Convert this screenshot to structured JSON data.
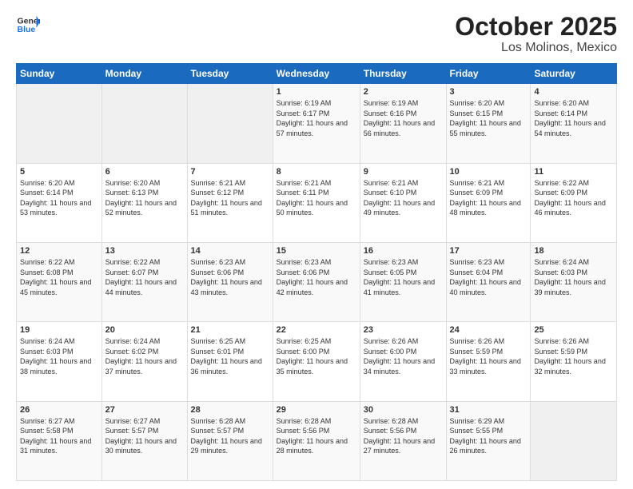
{
  "header": {
    "logo_general": "General",
    "logo_blue": "Blue",
    "month_title": "October 2025",
    "location": "Los Molinos, Mexico"
  },
  "days_of_week": [
    "Sunday",
    "Monday",
    "Tuesday",
    "Wednesday",
    "Thursday",
    "Friday",
    "Saturday"
  ],
  "weeks": [
    [
      {
        "day": "",
        "info": ""
      },
      {
        "day": "",
        "info": ""
      },
      {
        "day": "",
        "info": ""
      },
      {
        "day": "1",
        "info": "Sunrise: 6:19 AM\nSunset: 6:17 PM\nDaylight: 11 hours and 57 minutes."
      },
      {
        "day": "2",
        "info": "Sunrise: 6:19 AM\nSunset: 6:16 PM\nDaylight: 11 hours and 56 minutes."
      },
      {
        "day": "3",
        "info": "Sunrise: 6:20 AM\nSunset: 6:15 PM\nDaylight: 11 hours and 55 minutes."
      },
      {
        "day": "4",
        "info": "Sunrise: 6:20 AM\nSunset: 6:14 PM\nDaylight: 11 hours and 54 minutes."
      }
    ],
    [
      {
        "day": "5",
        "info": "Sunrise: 6:20 AM\nSunset: 6:14 PM\nDaylight: 11 hours and 53 minutes."
      },
      {
        "day": "6",
        "info": "Sunrise: 6:20 AM\nSunset: 6:13 PM\nDaylight: 11 hours and 52 minutes."
      },
      {
        "day": "7",
        "info": "Sunrise: 6:21 AM\nSunset: 6:12 PM\nDaylight: 11 hours and 51 minutes."
      },
      {
        "day": "8",
        "info": "Sunrise: 6:21 AM\nSunset: 6:11 PM\nDaylight: 11 hours and 50 minutes."
      },
      {
        "day": "9",
        "info": "Sunrise: 6:21 AM\nSunset: 6:10 PM\nDaylight: 11 hours and 49 minutes."
      },
      {
        "day": "10",
        "info": "Sunrise: 6:21 AM\nSunset: 6:09 PM\nDaylight: 11 hours and 48 minutes."
      },
      {
        "day": "11",
        "info": "Sunrise: 6:22 AM\nSunset: 6:09 PM\nDaylight: 11 hours and 46 minutes."
      }
    ],
    [
      {
        "day": "12",
        "info": "Sunrise: 6:22 AM\nSunset: 6:08 PM\nDaylight: 11 hours and 45 minutes."
      },
      {
        "day": "13",
        "info": "Sunrise: 6:22 AM\nSunset: 6:07 PM\nDaylight: 11 hours and 44 minutes."
      },
      {
        "day": "14",
        "info": "Sunrise: 6:23 AM\nSunset: 6:06 PM\nDaylight: 11 hours and 43 minutes."
      },
      {
        "day": "15",
        "info": "Sunrise: 6:23 AM\nSunset: 6:06 PM\nDaylight: 11 hours and 42 minutes."
      },
      {
        "day": "16",
        "info": "Sunrise: 6:23 AM\nSunset: 6:05 PM\nDaylight: 11 hours and 41 minutes."
      },
      {
        "day": "17",
        "info": "Sunrise: 6:23 AM\nSunset: 6:04 PM\nDaylight: 11 hours and 40 minutes."
      },
      {
        "day": "18",
        "info": "Sunrise: 6:24 AM\nSunset: 6:03 PM\nDaylight: 11 hours and 39 minutes."
      }
    ],
    [
      {
        "day": "19",
        "info": "Sunrise: 6:24 AM\nSunset: 6:03 PM\nDaylight: 11 hours and 38 minutes."
      },
      {
        "day": "20",
        "info": "Sunrise: 6:24 AM\nSunset: 6:02 PM\nDaylight: 11 hours and 37 minutes."
      },
      {
        "day": "21",
        "info": "Sunrise: 6:25 AM\nSunset: 6:01 PM\nDaylight: 11 hours and 36 minutes."
      },
      {
        "day": "22",
        "info": "Sunrise: 6:25 AM\nSunset: 6:00 PM\nDaylight: 11 hours and 35 minutes."
      },
      {
        "day": "23",
        "info": "Sunrise: 6:26 AM\nSunset: 6:00 PM\nDaylight: 11 hours and 34 minutes."
      },
      {
        "day": "24",
        "info": "Sunrise: 6:26 AM\nSunset: 5:59 PM\nDaylight: 11 hours and 33 minutes."
      },
      {
        "day": "25",
        "info": "Sunrise: 6:26 AM\nSunset: 5:59 PM\nDaylight: 11 hours and 32 minutes."
      }
    ],
    [
      {
        "day": "26",
        "info": "Sunrise: 6:27 AM\nSunset: 5:58 PM\nDaylight: 11 hours and 31 minutes."
      },
      {
        "day": "27",
        "info": "Sunrise: 6:27 AM\nSunset: 5:57 PM\nDaylight: 11 hours and 30 minutes."
      },
      {
        "day": "28",
        "info": "Sunrise: 6:28 AM\nSunset: 5:57 PM\nDaylight: 11 hours and 29 minutes."
      },
      {
        "day": "29",
        "info": "Sunrise: 6:28 AM\nSunset: 5:56 PM\nDaylight: 11 hours and 28 minutes."
      },
      {
        "day": "30",
        "info": "Sunrise: 6:28 AM\nSunset: 5:56 PM\nDaylight: 11 hours and 27 minutes."
      },
      {
        "day": "31",
        "info": "Sunrise: 6:29 AM\nSunset: 5:55 PM\nDaylight: 11 hours and 26 minutes."
      },
      {
        "day": "",
        "info": ""
      }
    ]
  ]
}
